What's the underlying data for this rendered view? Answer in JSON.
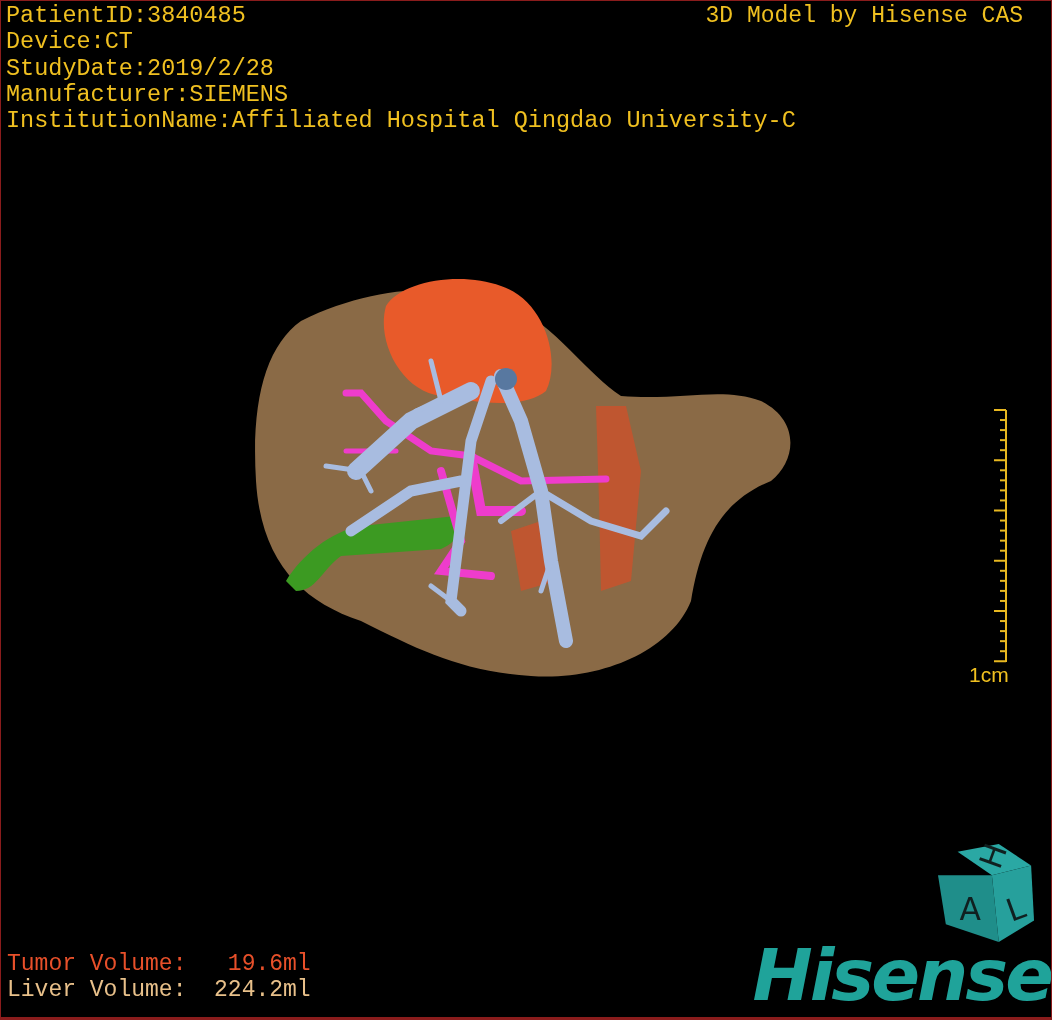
{
  "info_lines": [
    "PatientID:3840485",
    "Device:CT",
    "StudyDate:2019/2/28",
    "Manufacturer:SIEMENS",
    "InstitutionName:Affiliated Hospital Qingdao University-C"
  ],
  "title": "3D Model by Hisense CAS",
  "scale_bar": {
    "label": "1cm"
  },
  "volumes": [
    {
      "text": "Tumor Volume:   19.6ml",
      "color": "#e8502a"
    },
    {
      "text": "Liver Volume:  224.2ml",
      "color": "#e8c08a"
    }
  ],
  "orientation_cube": {
    "top": "H",
    "right": "L",
    "front": "A"
  },
  "logo": "Hisense"
}
